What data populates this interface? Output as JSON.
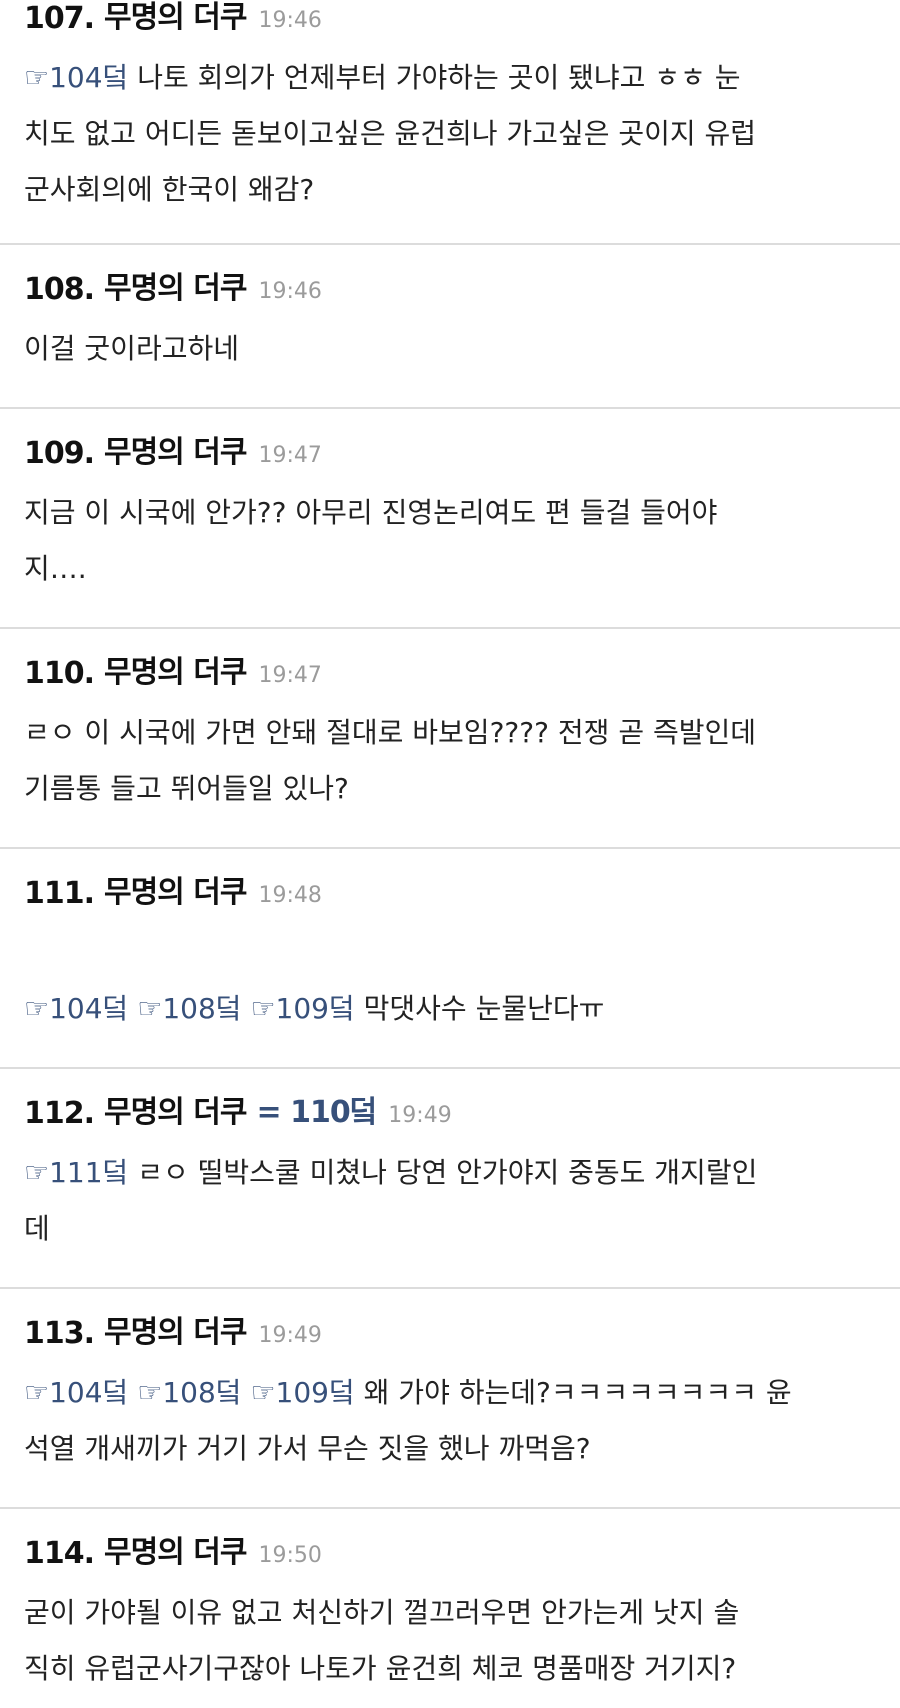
{
  "posts": [
    {
      "num": "107.",
      "author": "무명의 더쿠",
      "time": "19:46",
      "anchors": [
        "☞104덬"
      ],
      "lines": [
        " 나토 회의가 언제부터 가야하는 곳이 됐냐고 ㅎㅎ 눈",
        "치도 없고 어디든 돋보이고싶은 윤건희나 가고싶은 곳이지 유럽",
        "군사회의에 한국이 왜감?"
      ]
    },
    {
      "num": "108.",
      "author": "무명의 더쿠",
      "time": "19:46",
      "lines": [
        "이걸 굿이라고하네"
      ]
    },
    {
      "num": "109.",
      "author": "무명의 더쿠",
      "time": "19:47",
      "lines": [
        "지금 이 시국에 안가?? 아무리 진영논리여도 편 들걸 들어야",
        "지….  "
      ]
    },
    {
      "num": "110.",
      "author": "무명의 더쿠",
      "time": "19:47",
      "lines": [
        "ㄹㅇ 이 시국에 가면 안돼 절대로 바보임???? 전쟁 곧 즉발인데",
        "기름통 들고 뛰어들일 있나?"
      ]
    },
    {
      "num": "111.",
      "author": "무명의 더쿠",
      "time": "19:48",
      "anchors": [
        "☞104덬",
        "☞108덬",
        "☞109덬"
      ],
      "lines": [
        " 막댓사수 눈물난다ㅠ"
      ]
    },
    {
      "num": "112.",
      "author": "무명의 더쿠",
      "ref": "= 110덬",
      "time": "19:49",
      "anchors": [
        "☞111덬"
      ],
      "lines": [
        " ㄹㅇ 띨박스쿨 미쳤나 당연 안가야지 중동도 개지랄인",
        "데"
      ]
    },
    {
      "num": "113.",
      "author": "무명의 더쿠",
      "time": "19:49",
      "anchors": [
        "☞104덬",
        "☞108덬",
        "☞109덬"
      ],
      "lines": [
        " 왜 가야 하는데?ㅋㅋㅋㅋㅋㅋㅋㅋ 윤",
        "석열 개새끼가 거기 가서 무슨 짓을 했나 까먹음?"
      ]
    },
    {
      "num": "114.",
      "author": "무명의 더쿠",
      "time": "19:50",
      "lines": [
        "굳이 가야될 이유 없고 처신하기 껄끄러우면 안가는게 낫지 솔",
        "직히 유럽군사기구잖아 나토가 윤건희 체코 명품매장 거기지?"
      ]
    }
  ]
}
